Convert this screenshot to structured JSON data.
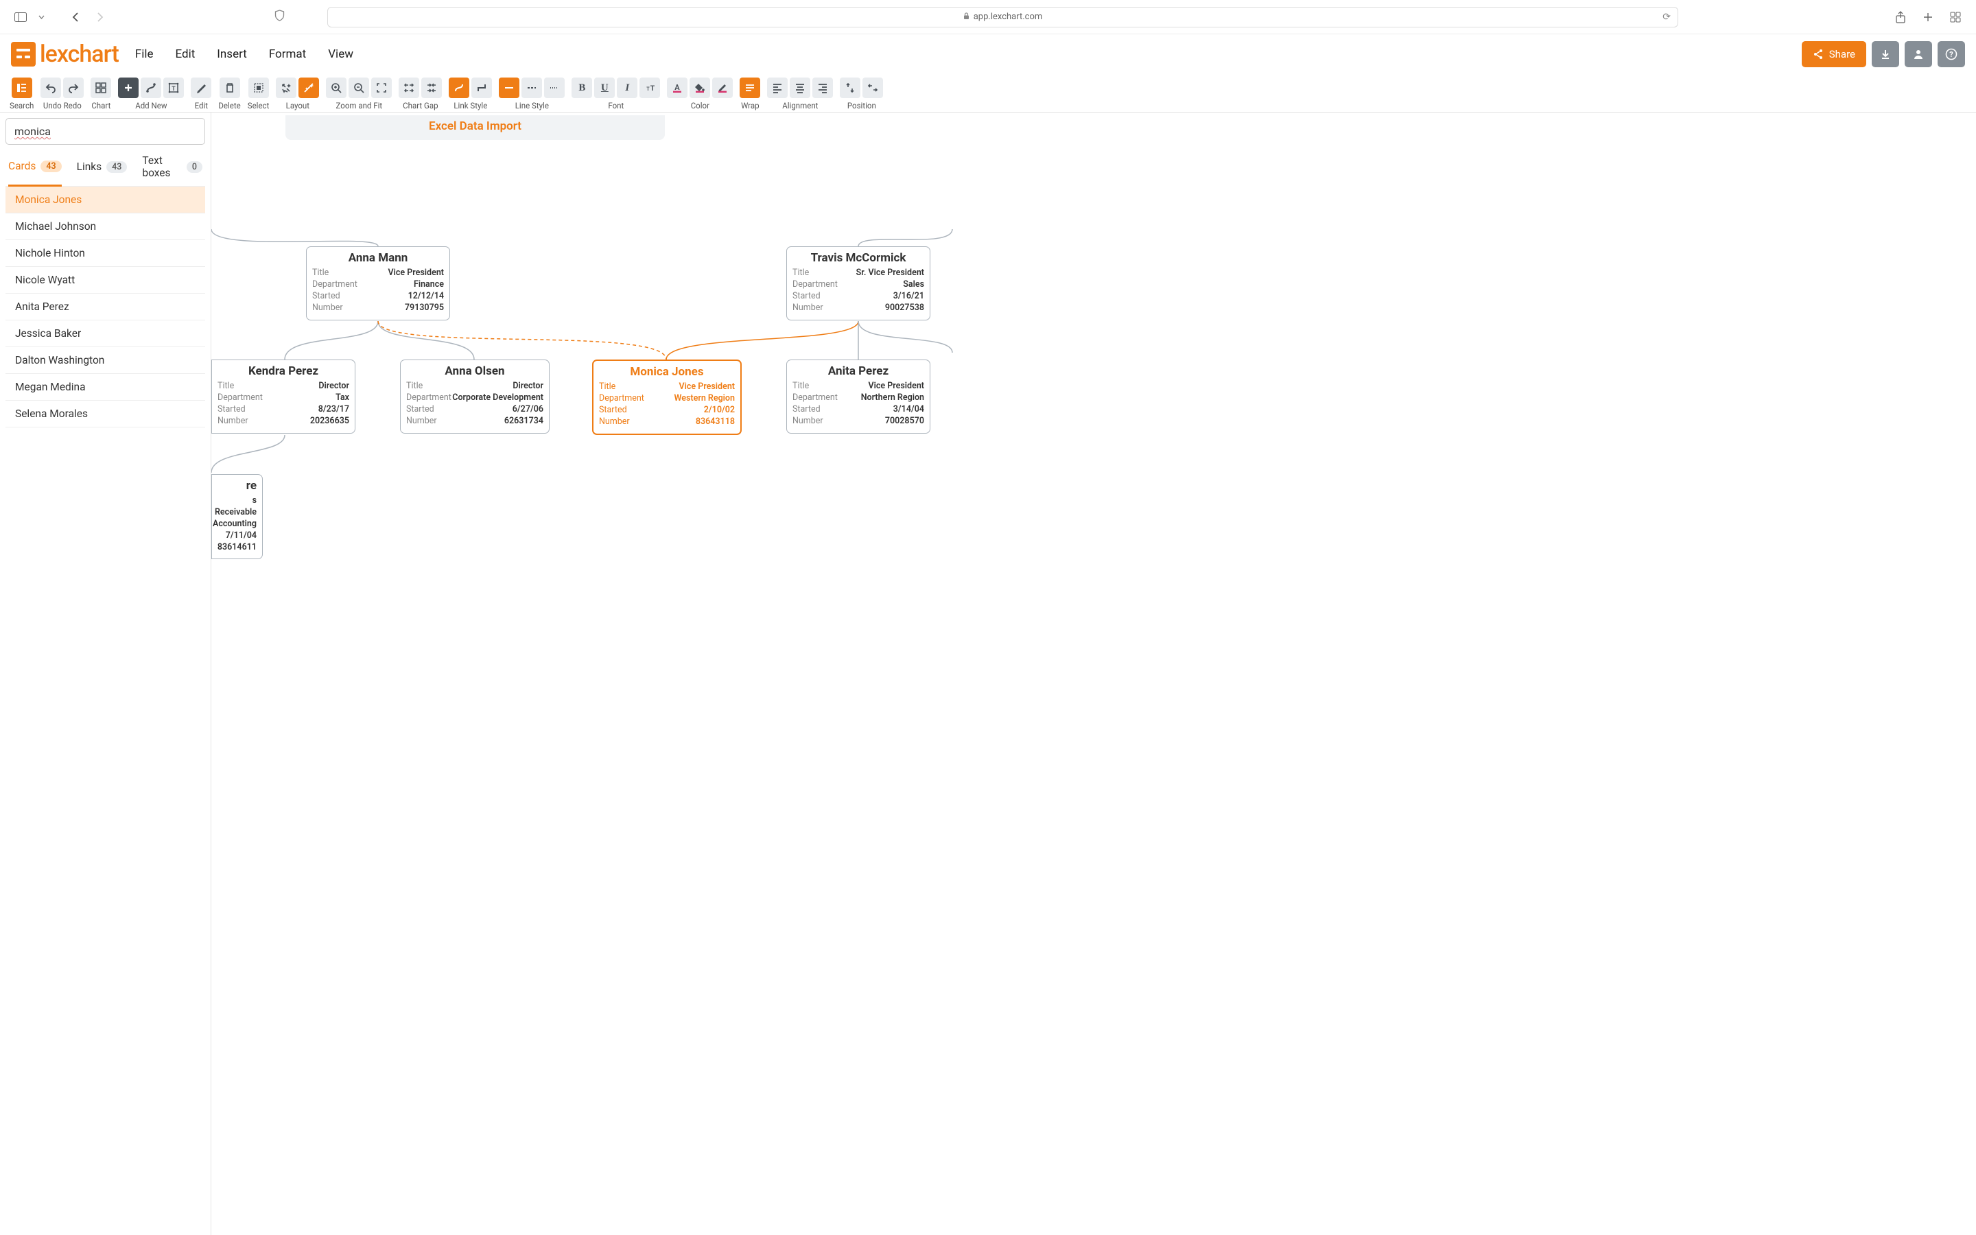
{
  "browser": {
    "url": "app.lexchart.com"
  },
  "brand": "lexchart",
  "menu": {
    "file": "File",
    "edit": "Edit",
    "insert": "Insert",
    "format": "Format",
    "view": "View"
  },
  "header": {
    "share": "Share"
  },
  "toolbar": {
    "search": "Search",
    "undo_redo": "Undo Redo",
    "chart": "Chart",
    "add_new": "Add New",
    "edit": "Edit",
    "delete": "Delete",
    "select": "Select",
    "layout": "Layout",
    "zoom_fit": "Zoom and Fit",
    "chart_gap": "Chart Gap",
    "link_style": "Link Style",
    "line_style": "Line Style",
    "font": "Font",
    "color": "Color",
    "wrap": "Wrap",
    "alignment": "Alignment",
    "position": "Position"
  },
  "search": {
    "query": "monica"
  },
  "tabs": {
    "cards": {
      "label": "Cards",
      "count": "43"
    },
    "links": {
      "label": "Links",
      "count": "43"
    },
    "textboxes": {
      "label": "Text boxes",
      "count": "0"
    }
  },
  "results": [
    "Monica Jones",
    "Michael Johnson",
    "Nichole Hinton",
    "Nicole Wyatt",
    "Anita Perez",
    "Jessica Baker",
    "Dalton Washington",
    "Megan Medina",
    "Selena Morales"
  ],
  "doc_title": "Excel Data Import",
  "field_labels": {
    "title": "Title",
    "department": "Department",
    "started": "Started",
    "number": "Number"
  },
  "cards": {
    "anna_mann": {
      "name": "Anna Mann",
      "title": "Vice President",
      "department": "Finance",
      "started": "12/12/14",
      "number": "79130795"
    },
    "travis": {
      "name": "Travis McCormick",
      "title": "Sr. Vice President",
      "department": "Sales",
      "started": "3/16/21",
      "number": "90027538"
    },
    "kendra": {
      "name": "Kendra Perez",
      "title": "Director",
      "department": "Tax",
      "started": "8/23/17",
      "number": "20236635"
    },
    "anna_o": {
      "name": "Anna Olsen",
      "title": "Director",
      "department": "Corporate Development",
      "started": "6/27/06",
      "number": "62631734"
    },
    "monica": {
      "name": "Monica Jones",
      "title": "Vice President",
      "department": "Western Region",
      "started": "2/10/02",
      "number": "83643118"
    },
    "anita": {
      "name": "Anita Perez",
      "title": "Vice President",
      "department": "Northern Region",
      "started": "3/14/04",
      "number": "70028570"
    },
    "clipped": {
      "name": "re",
      "title": "s Receivable",
      "department": "Accounting",
      "started": "7/11/04",
      "number": "83614611"
    }
  }
}
